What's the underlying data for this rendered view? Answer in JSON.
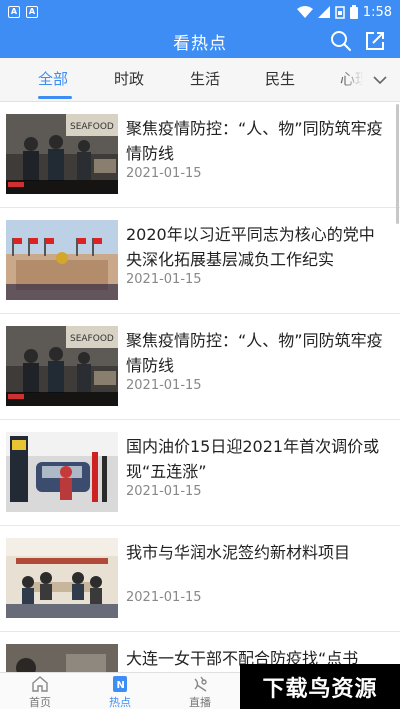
{
  "status_bar": {
    "time": "1:58",
    "left_icon_1": "A-box",
    "left_icon_2": "A",
    "icons": [
      "wifi-icon",
      "signal-icon",
      "sim-icon",
      "battery-icon"
    ]
  },
  "header": {
    "title": "看热点"
  },
  "tabs": [
    {
      "label": "全部",
      "active": true
    },
    {
      "label": "时政"
    },
    {
      "label": "生活"
    },
    {
      "label": "民生"
    },
    {
      "label": "心理"
    }
  ],
  "news": [
    {
      "title": "聚焦疫情防控：“人、物”同防筑牢疫情防线",
      "date": "2021-01-15",
      "thumb": "market-scene"
    },
    {
      "title": "2020年以习近平同志为核心的党中央深化拓展基层减负工作纪实",
      "date": "2021-01-15",
      "thumb": "great-hall"
    },
    {
      "title": "聚焦疫情防控：“人、物”同防筑牢疫情防线",
      "date": "2021-01-15",
      "thumb": "market-scene"
    },
    {
      "title": "国内油价15日迎2021年首次调价或现“五连涨”",
      "date": "2021-01-15",
      "thumb": "gas-station"
    },
    {
      "title": "我市与华润水泥签约新材料项目",
      "date": "2021-01-15",
      "thumb": "meeting-room"
    },
    {
      "title": "大连一女干部不配合防疫找“点书",
      "date": "",
      "thumb": "person"
    }
  ],
  "bottom_nav": [
    {
      "label": "首页",
      "icon": "home-icon"
    },
    {
      "label": "热点",
      "icon": "news-icon",
      "active": true
    },
    {
      "label": "直播",
      "icon": "live-icon"
    }
  ],
  "watermark": "下载鸟资源",
  "colors": {
    "primary": "#3d8df5",
    "text": "#222222",
    "muted": "#888888"
  }
}
